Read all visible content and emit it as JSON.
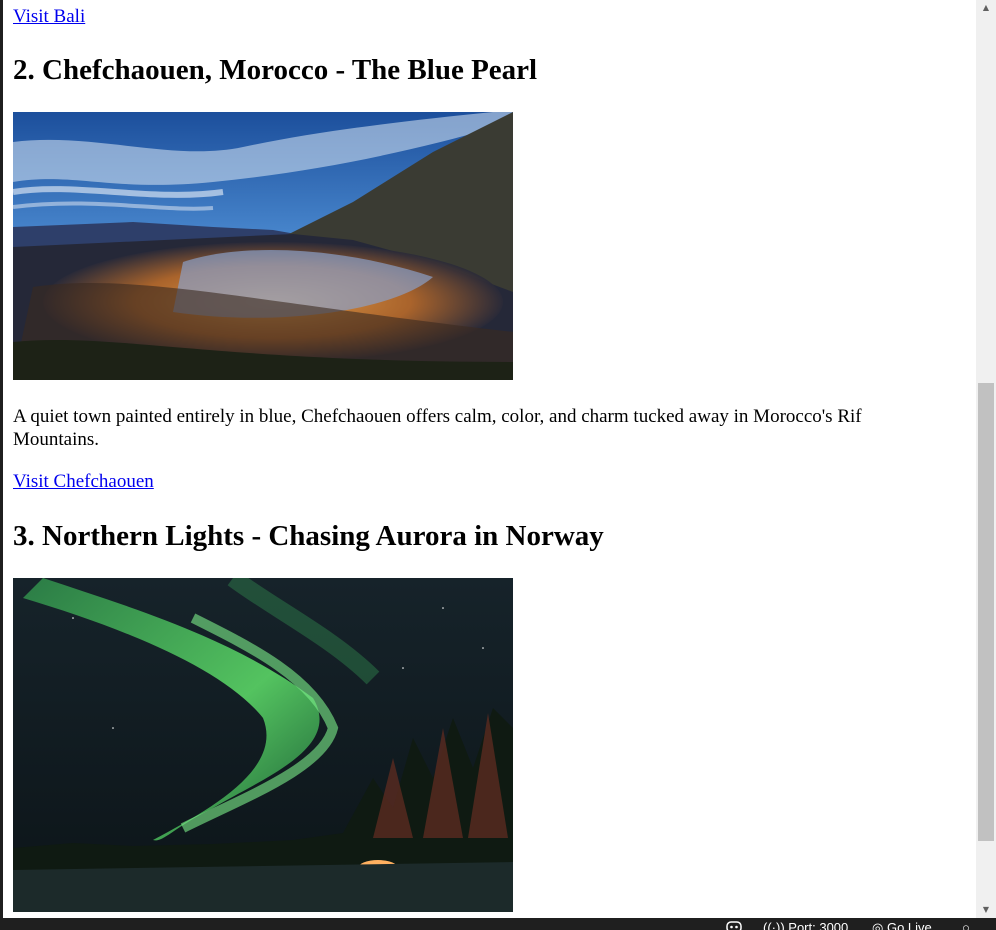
{
  "page": {
    "links": {
      "visit_bali": "Visit Bali",
      "visit_chefchaouen": "Visit Chefchaouen"
    },
    "sections": [
      {
        "heading": "2. Chefchaouen, Morocco - The Blue Pearl",
        "description": "A quiet town painted entirely in blue, Chefchaouen offers calm, color, and charm tucked away in Morocco's Rif Mountains."
      },
      {
        "heading": "3. Northern Lights - Chasing Aurora in Norway"
      }
    ]
  },
  "status_bar": {
    "port_label": "Port: 3000",
    "go_live_label": "Go Live"
  },
  "colors": {
    "link": "#0000ee",
    "statusbar_bg": "#1f1f1f",
    "scrollbar_thumb": "#c1c1c1"
  },
  "icons": {
    "copilot": "copilot-icon",
    "port": "broadcast-icon",
    "go_live": "go-live-icon",
    "notifications": "bell-icon"
  }
}
